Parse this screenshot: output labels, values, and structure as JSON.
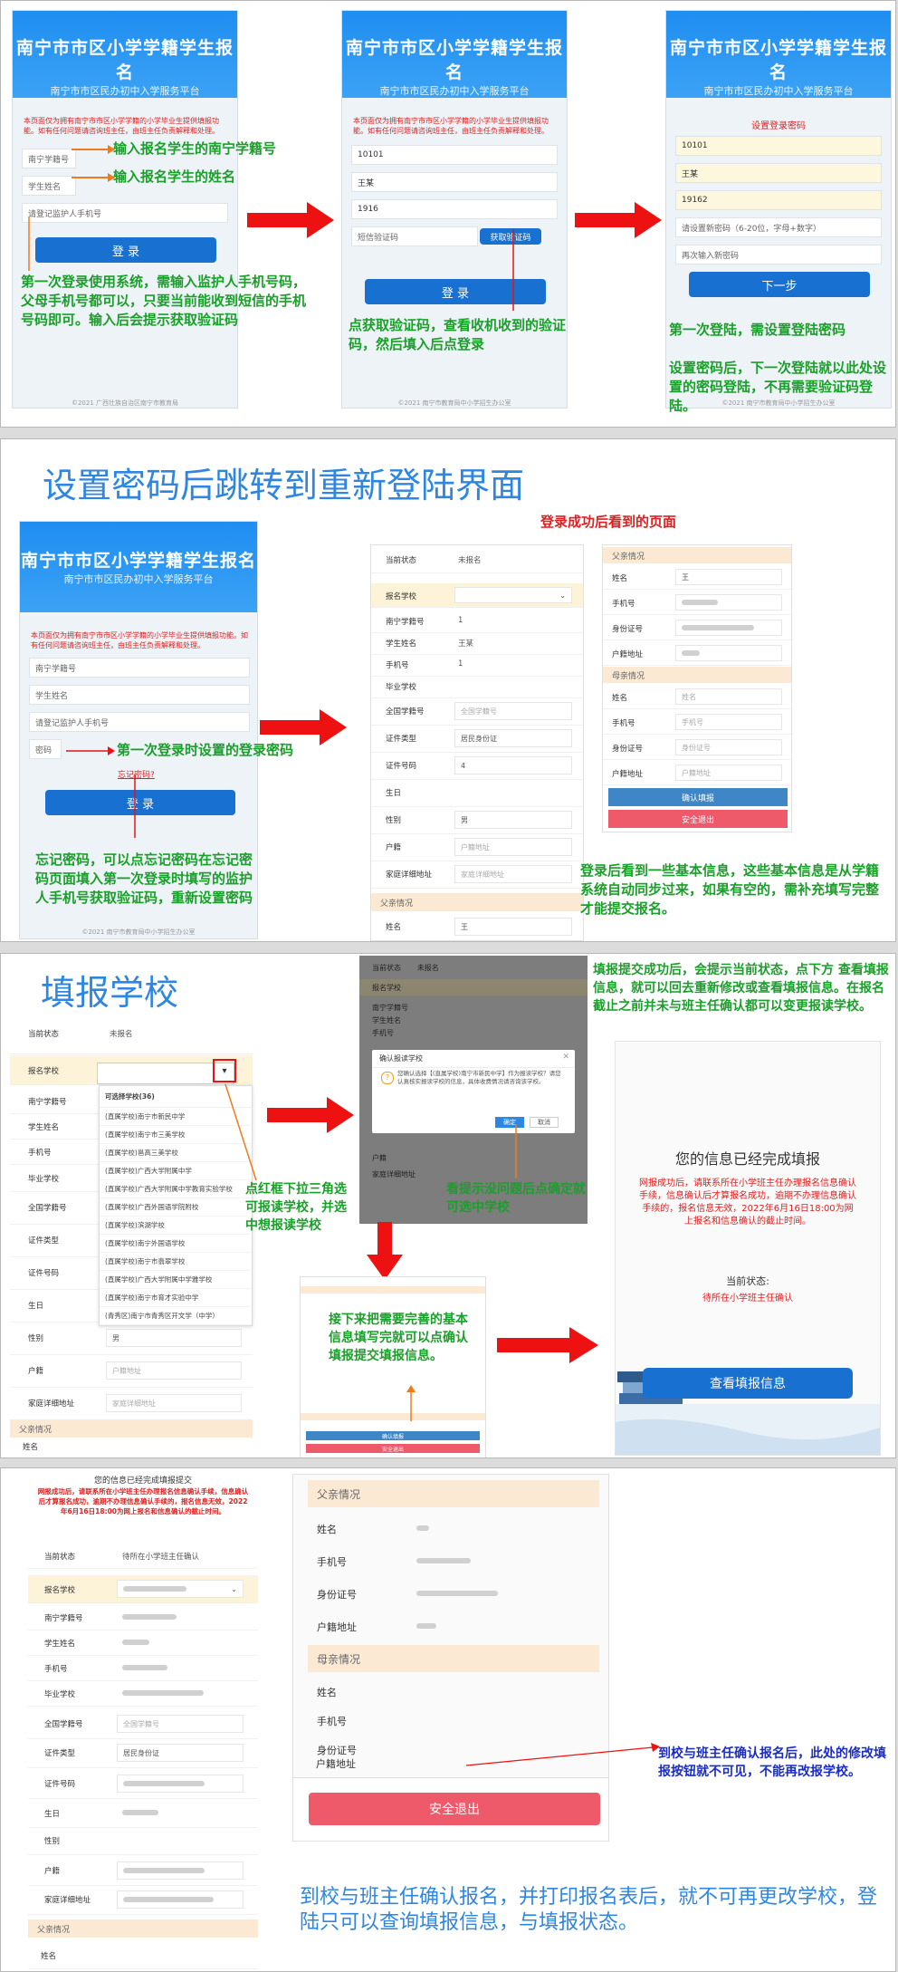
{
  "app": {
    "title": "南宁市市区小学学籍学生报名",
    "subtitle": "南宁市市区民办初中入学服务平台",
    "notice": "本页面仅为拥有南宁市市区小学学籍的小学毕业生提供填报功能。如有任何问题请咨询班主任，由班主任负责解释和处理。",
    "footer1": "©2021 广西壮族自治区南宁市教育局",
    "footer2": "©2021 南宁市教育局中小学招生办公室"
  },
  "login": {
    "xjh_ph": "南宁学籍号",
    "name_ph": "学生姓名",
    "phone_ph": "请登记监护人手机号",
    "pwd_ph": "密码",
    "login_btn": "登 录",
    "forgot": "忘记密码?",
    "code_ph": "短信验证码",
    "get_code": "获取验证码",
    "xjh_val": "10101",
    "name_val": "王某",
    "phone_val": "1916"
  },
  "setpwd": {
    "title": "设置登录密码",
    "xjh_val": "10101",
    "name_val": "王某",
    "phone_val": "19162",
    "newpwd_ph": "请设置新密码（6-20位，字母+数字）",
    "repwd_ph": "再次输入新密码",
    "next_btn": "下一步"
  },
  "ann": {
    "a1": "输入报名学生的南宁学籍号",
    "a2": "输入报名学生的姓名",
    "a3": "第一次登录使用系统，需输入监护人手机号码，父母手机号都可以，只要当前能收到短信的手机号码即可。输入后会提示获取验证码",
    "a4": "点获取验证码，查看收机收到的验证码，然后填入后点登录",
    "a5": "第一次登陆，需设置登陆密码",
    "a6": "设置密码后，下一次登陆就以此处设置的密码登陆，不再需要验证码登陆。",
    "s2title": "设置密码后跳转到重新登陆界面",
    "s2sub": "登录成功后看到的页面",
    "a7": "第一次登录时设置的登录密码",
    "a8": "忘记密码，可以点忘记密码在忘记密码页面填入第一次登录时填写的监护人手机号获取验证码，重新设置密码",
    "a9": "登录后看到一些基本信息，这些基本信息是从学籍系统自动同步过来，如果有空的，需补充填写完整才能提交报名。",
    "s3title": "填报学校",
    "a10": "点红框下拉三角选可报读学校，并选中想报读学校",
    "a11": "看提示没问题后点确定就可选中学校",
    "a12": "接下来把需要完善的基本信息填写完就可以点确认填报提交填报信息。",
    "a13": "填报提交成功后，会提示当前状态，点下方 查看填报信息，就可以回去重新修改或查看填报信息。在报名截止之前并未与班主任确认都可以变更报读学校。",
    "a14": "到校与班主任确认报名后，此处的修改填报按钮就不可见，不能再改报学校。",
    "a15": "到校与班主任确认报名，并打印报名表后，就不可再更改学校，登陆只可以查询填报信息，与填报状态。"
  },
  "form": {
    "status_lb": "当前状态",
    "status_val": "未报名",
    "school_lb": "报名学校",
    "xjh_lb": "南宁学籍号",
    "xjh_val": "1",
    "name_lb": "学生姓名",
    "name_val": "王某",
    "phone_lb": "手机号",
    "phone_val": "1",
    "grad_lb": "毕业学校",
    "qgxjh_lb": "全国学籍号",
    "qgxjh_ph": "全国学籍号",
    "idtype_lb": "证件类型",
    "idtype_val": "居民身份证",
    "idno_lb": "证件号码",
    "idno_val": "4",
    "birth_lb": "生日",
    "sex_lb": "性别",
    "sex_val": "男",
    "hj_lb": "户籍",
    "hj_ph": "户籍地址",
    "addr_lb": "家庭详细地址",
    "addr_ph": "家庭详细地址",
    "father_sec": "父亲情况",
    "mother_sec": "母亲情况",
    "f_name": "姓名",
    "f_name_val": "王",
    "f_phone": "手机号",
    "f_id": "身份证号",
    "f_hj": "户籍地址",
    "m_name_ph": "姓名",
    "m_phone_ph": "手机号",
    "m_id_ph": "身份证号",
    "m_hj_ph": "户籍地址",
    "confirm_btn": "确认填报",
    "logout_btn": "安全退出",
    "status_val2": "待所在小学班主任确认"
  },
  "dropdown": {
    "head": "可选择学校(36)",
    "items": [
      "(直属学校)南宁市新民中学",
      "(直属学校)南宁市三美学校",
      "(直属学校)邕高三美学校",
      "(直属学校)广西大学附属中学",
      "(直属学校)广西大学附属中学教育实验学校",
      "(直属学校)广西外国语学院附校",
      "(直属学校)滨湖学校",
      "(直属学校)南宁外国语学校",
      "(直属学校)南宁市翡翠学校",
      "(直属学校)广西大学附属中学雅学校",
      "(直属学校)南宁市育才实验中学",
      "(青秀区)南宁市青秀区开文学（中学）"
    ]
  },
  "dialog": {
    "title": "确认报读学校",
    "body": "您确认选择【(直属学校)南宁市新民中学】作为报读学校？请您认真核实报读学校的信息，具体收费情况请咨询该学校。",
    "ok": "确定",
    "cancel": "取消"
  },
  "done": {
    "title": "您的信息已经完成填报",
    "notice": "网报成功后，请联系所在小学班主任办理报名信息确认手续，信息确认后才算报名成功，逾期不办理信息确认手续的，报名信息无效，2022年6月16日18:00为网上报名和信息确认的截止时间。",
    "state_lb": "当前状态:",
    "state_val": "待所在小学班主任确认",
    "view_btn": "查看填报信息",
    "top_title": "您的信息已经完成填报提交"
  },
  "colors": {
    "blue": "#1f8ef1",
    "red": "#e02020",
    "green": "#1aa02a",
    "title_blue": "#2f86e0"
  }
}
